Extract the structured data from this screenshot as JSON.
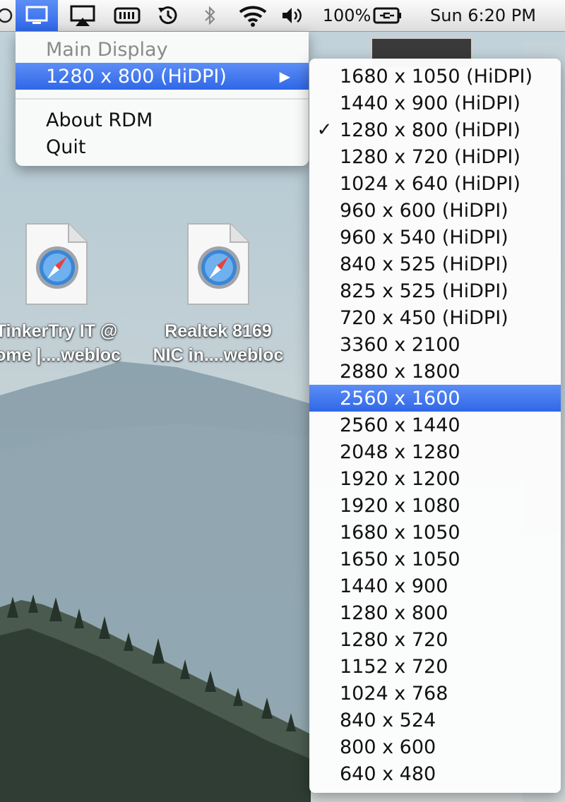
{
  "menubar": {
    "battery_percent": "100%",
    "clock": "Sun 6:20 PM",
    "icons": [
      "circle-icon",
      "display-icon",
      "airplay-icon",
      "battery-meter-icon",
      "time-machine-icon",
      "bluetooth-icon",
      "wifi-icon",
      "volume-icon",
      "battery-charging-icon"
    ]
  },
  "rdm_menu": {
    "header": "Main Display",
    "current_mode": "1280 x 800 (HiDPI)",
    "about": "About RDM",
    "quit": "Quit"
  },
  "submenu": {
    "checked_index": 2,
    "highlighted_index": 12,
    "items": [
      "1680 x 1050 (HiDPI)",
      "1440 x 900 (HiDPI)",
      "1280 x 800 (HiDPI)",
      "1280 x 720 (HiDPI)",
      "1024 x 640 (HiDPI)",
      "960 x 600 (HiDPI)",
      "960 x 540 (HiDPI)",
      "840 x 525 (HiDPI)",
      "825 x 525 (HiDPI)",
      "720 x 450 (HiDPI)",
      "3360 x 2100",
      "2880 x 1800",
      "2560 x 1600",
      "2560 x 1440",
      "2048 x 1280",
      "1920 x 1200",
      "1920 x 1080",
      "1680 x 1050",
      "1650 x 1050",
      "1440 x 900",
      "1280 x 800",
      "1280 x 720",
      "1152 x 720",
      "1024 x 768",
      "840 x 524",
      "800 x 600",
      "640 x 480"
    ]
  },
  "desktop": {
    "files": [
      {
        "line1": "TinkerTry IT @",
        "line2": "ome |....webloc"
      },
      {
        "line1": "Realtek 8169",
        "line2": "NIC in....webloc"
      }
    ]
  }
}
